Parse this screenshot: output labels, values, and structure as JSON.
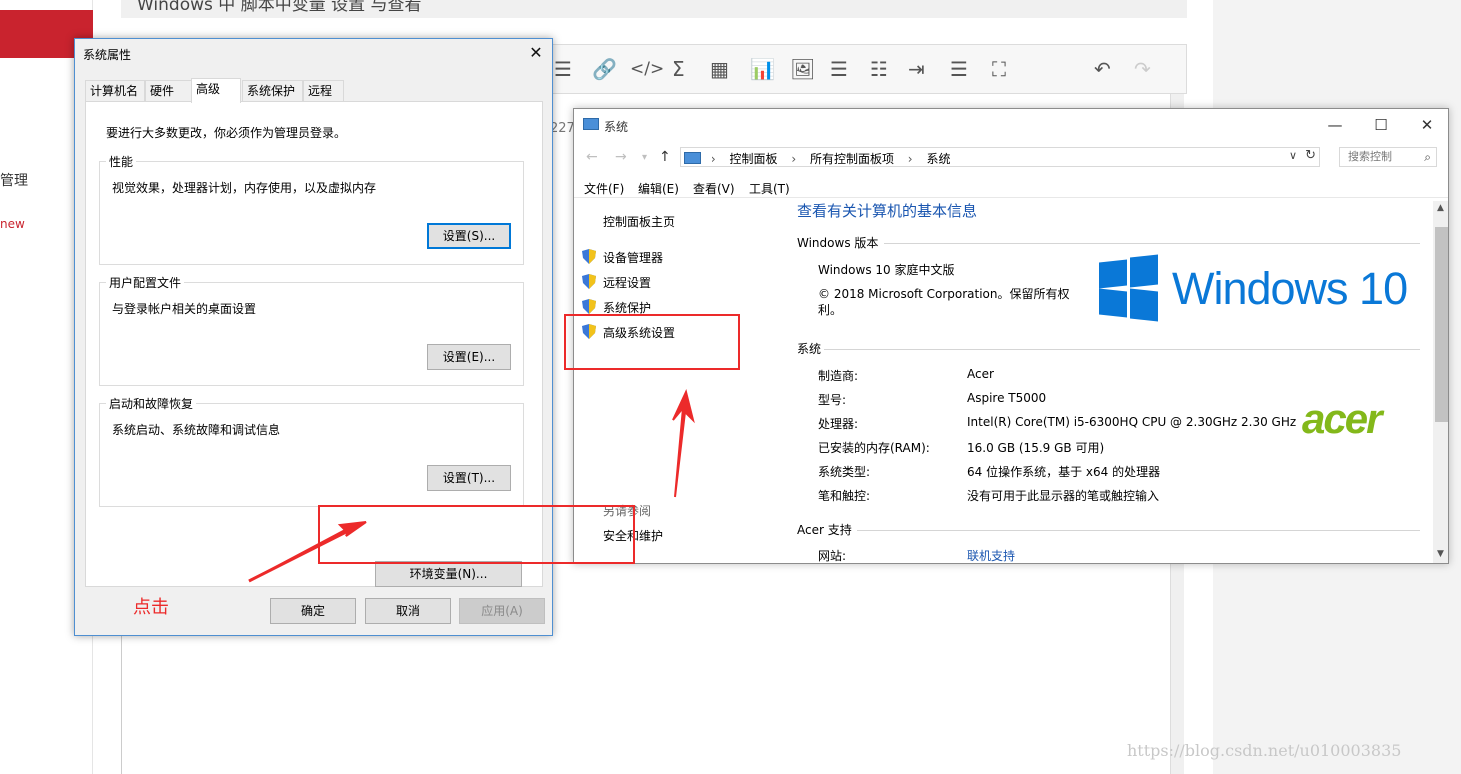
{
  "background": {
    "title": "Windows 中 脚本中变量 设置 与查看",
    "left_text_manage": "管理",
    "left_text_new": "new",
    "editor_number": "227",
    "watermark": "https://blog.csdn.net/u010003835"
  },
  "sysprops": {
    "title": "系统属性",
    "tabs": [
      "计算机名",
      "硬件",
      "高级",
      "系统保护",
      "远程"
    ],
    "note": "要进行大多数更改，你必须作为管理员登录。",
    "groups": [
      {
        "label": "性能",
        "desc": "视觉效果，处理器计划，内存使用，以及虚拟内存",
        "button": "设置(S)..."
      },
      {
        "label": "用户配置文件",
        "desc": "与登录帐户相关的桌面设置",
        "button": "设置(E)..."
      },
      {
        "label": "启动和故障恢复",
        "desc": "系统启动、系统故障和调试信息",
        "button": "设置(T)..."
      }
    ],
    "env_button": "环境变量(N)...",
    "ok": "确定",
    "cancel": "取消",
    "apply": "应用(A)"
  },
  "syswin": {
    "title": "系统",
    "breadcrumb": [
      "控制面板",
      "所有控制面板项",
      "系统"
    ],
    "search_placeholder": "搜索控制",
    "menu": [
      "文件(F)",
      "编辑(E)",
      "查看(V)",
      "工具(T)"
    ],
    "nav_home": "控制面板主页",
    "nav_items": [
      "设备管理器",
      "远程设置",
      "系统保护",
      "高级系统设置"
    ],
    "see_also": "另请参阅",
    "security": "安全和维护",
    "heading": "查看有关计算机的基本信息",
    "edition_title": "Windows 版本",
    "edition": "Windows 10 家庭中文版",
    "copyright": "© 2018 Microsoft Corporation。保留所有权利。",
    "windows_logo_text": "Windows 10",
    "system_title": "系统",
    "rows": [
      {
        "label": "制造商:",
        "value": "Acer"
      },
      {
        "label": "型号:",
        "value": "Aspire T5000"
      },
      {
        "label": "处理器:",
        "value": "Intel(R) Core(TM) i5-6300HQ CPU @ 2.30GHz   2.30 GHz"
      },
      {
        "label": "已安装的内存(RAM):",
        "value": "16.0 GB (15.9 GB 可用)"
      },
      {
        "label": "系统类型:",
        "value": "64 位操作系统，基于 x64 的处理器"
      },
      {
        "label": "笔和触控:",
        "value": "没有可用于此显示器的笔或触控输入"
      }
    ],
    "support_title": "Acer 支持",
    "website_label": "网站:",
    "website_value": "联机支持",
    "brand_logo_text": "acer"
  },
  "annotation": {
    "click_label": "点击"
  },
  "colors": {
    "annotation_red": "#ec2a2a",
    "link_blue": "#1a56b0",
    "windows_blue": "#0a78d7",
    "acer_green": "#83b81a"
  }
}
